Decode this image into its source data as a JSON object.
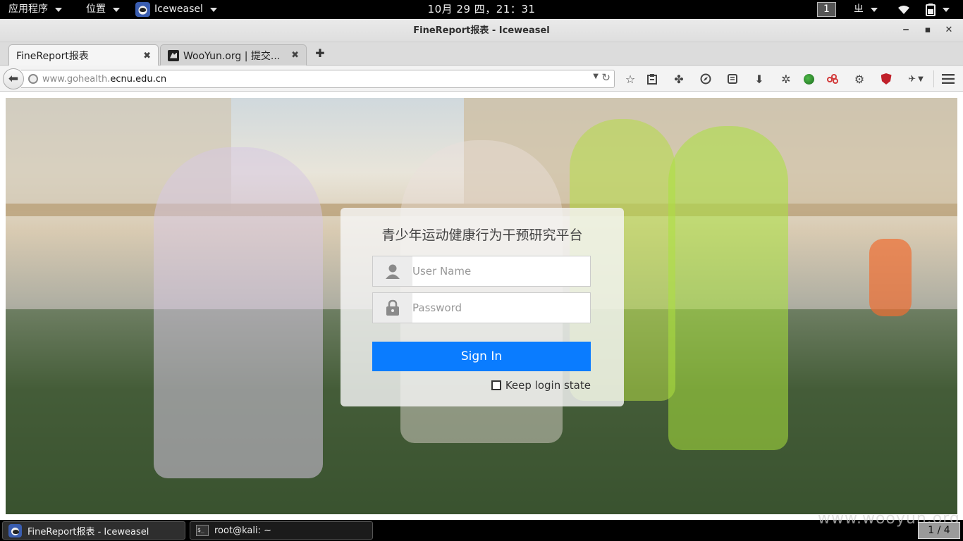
{
  "top_panel": {
    "applications_label": "应用程序",
    "places_label": "位置",
    "app_label": "Iceweasel",
    "clock": "10月 29 四，21：31",
    "workspace": "1",
    "input_method": "ㄓ"
  },
  "window": {
    "title": "FineReport报表 - Iceweasel"
  },
  "tabs": [
    {
      "label": "FineReport报表",
      "close": "✖"
    },
    {
      "label": "WooYun.org | 提交...",
      "close": "✖"
    }
  ],
  "nav": {
    "url_prefix": "www.gohealth.",
    "url_domain": "ecnu.edu.cn"
  },
  "login": {
    "title": "青少年运动健康行为干预研究平台",
    "username_placeholder": "User Name",
    "password_placeholder": "Password",
    "signin_label": "Sign In",
    "keep_login_label": "Keep login state"
  },
  "taskbar": {
    "items": [
      {
        "label": "FineReport报表 - Iceweasel"
      },
      {
        "label": "root@kali: ~"
      }
    ],
    "pager": "1 / 4",
    "watermark": "www.wooyun.org"
  },
  "colors": {
    "signin_bg": "#0a7cff",
    "panel_bg": "#000000"
  }
}
